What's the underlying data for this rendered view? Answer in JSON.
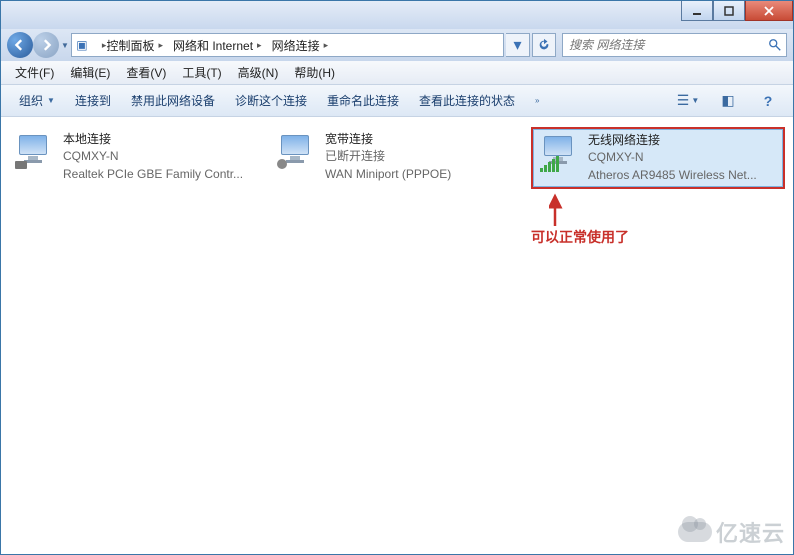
{
  "window_controls": {
    "min": "min",
    "max": "max",
    "close": "close"
  },
  "breadcrumbs": [
    "控制面板",
    "网络和 Internet",
    "网络连接"
  ],
  "search": {
    "placeholder": "搜索 网络连接"
  },
  "menubar": [
    "文件(F)",
    "编辑(E)",
    "查看(V)",
    "工具(T)",
    "高级(N)",
    "帮助(H)"
  ],
  "toolbar": {
    "organize": "组织",
    "connect": "连接到",
    "disable": "禁用此网络设备",
    "diagnose": "诊断这个连接",
    "rename": "重命名此连接",
    "viewstatus": "查看此连接的状态"
  },
  "connections": [
    {
      "name": "本地连接",
      "status": "CQMXY-N",
      "desc": "Realtek PCIe GBE Family Contr...",
      "icon": "lan"
    },
    {
      "name": "宽带连接",
      "status": "已断开连接",
      "desc": "WAN Miniport (PPPOE)",
      "icon": "wan"
    },
    {
      "name": "无线网络连接",
      "status": "CQMXY-N",
      "desc": "Atheros AR9485 Wireless Net...",
      "icon": "wifi"
    }
  ],
  "callout": "可以正常使用了",
  "watermark": "亿速云"
}
